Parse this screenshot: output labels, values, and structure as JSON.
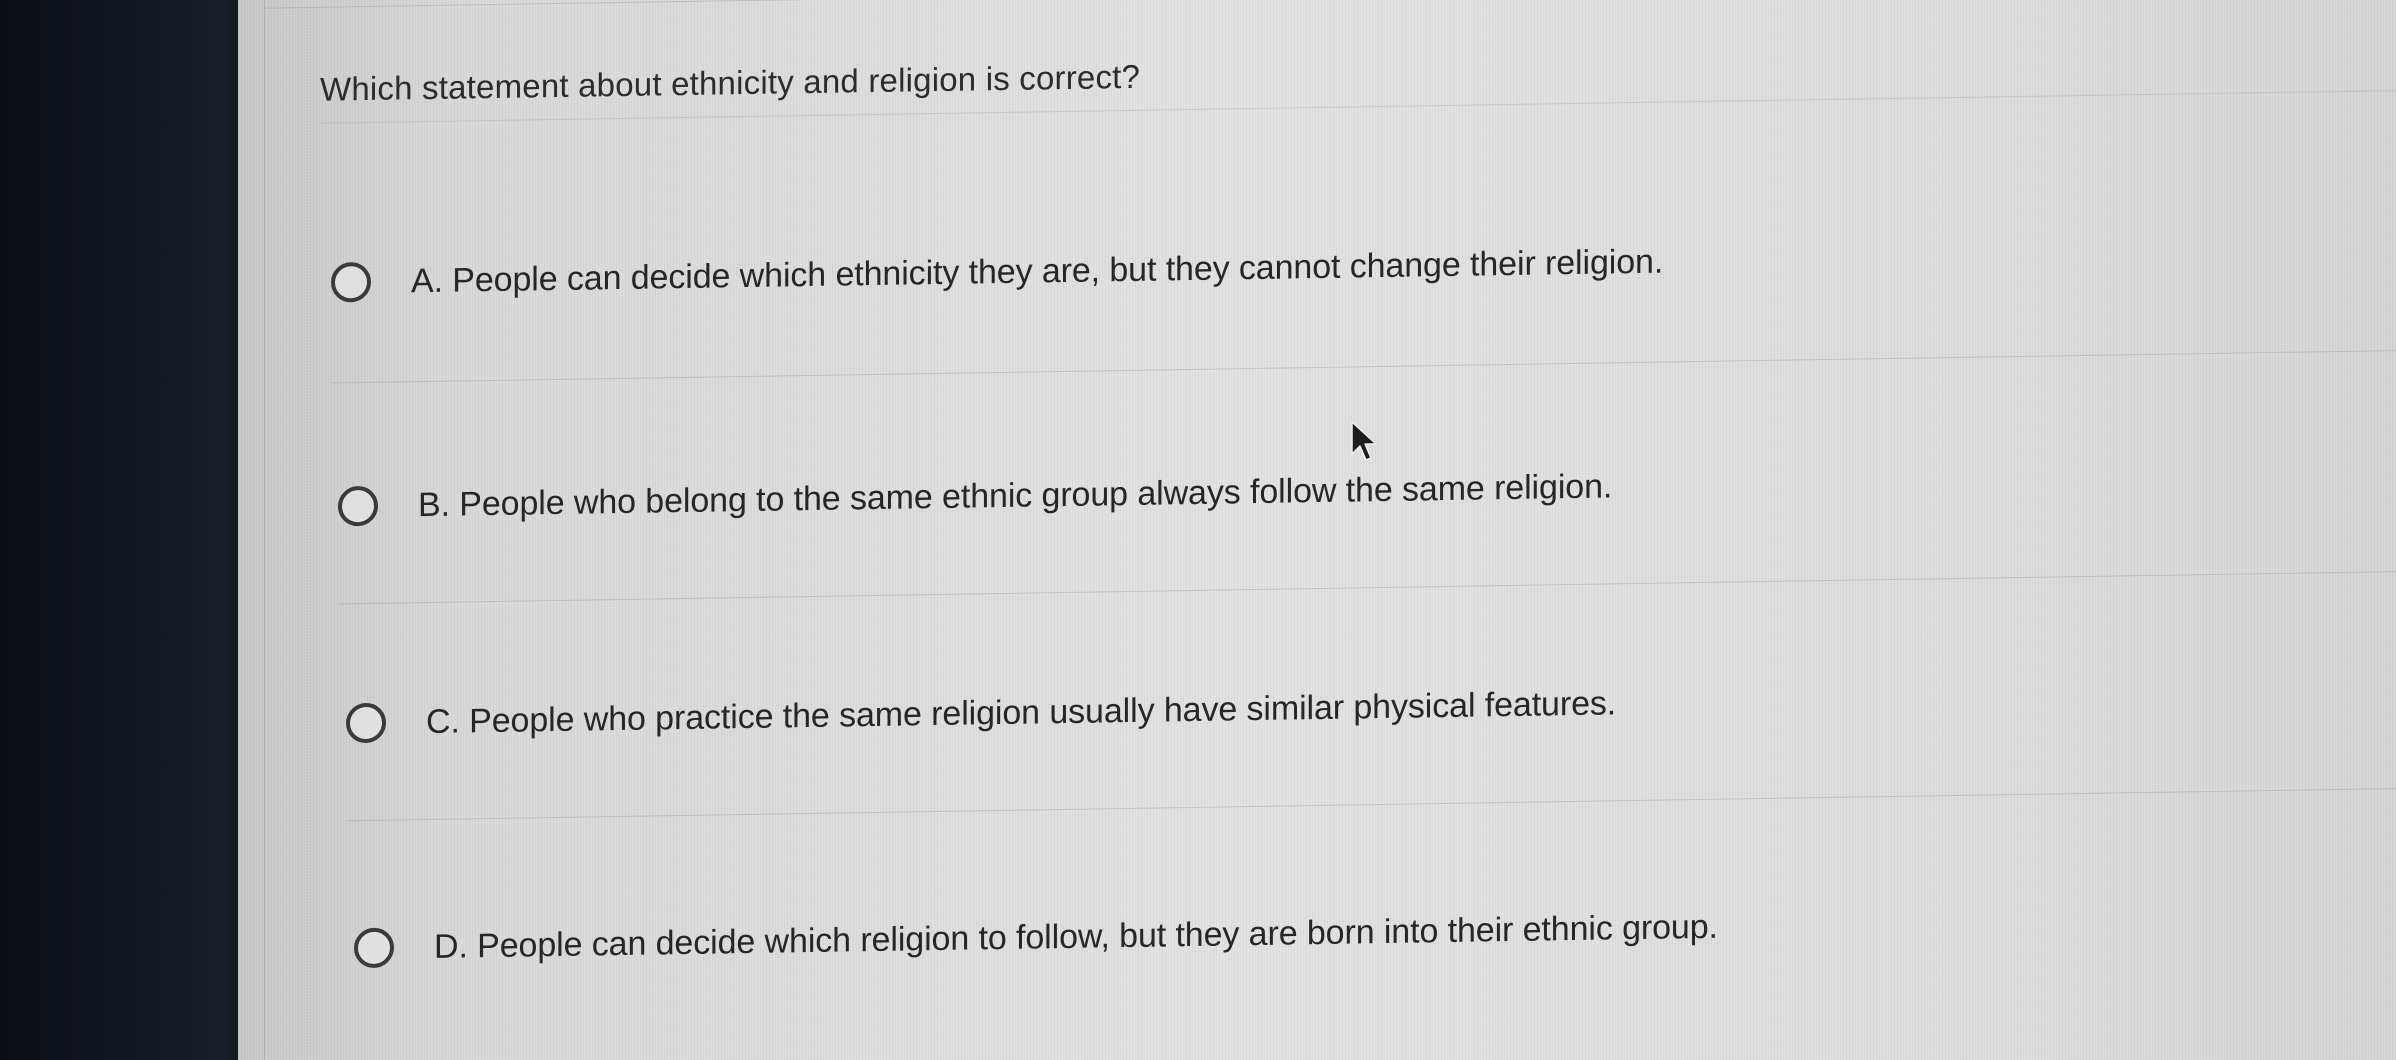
{
  "question": {
    "text": "Which statement about ethnicity and religion is correct?"
  },
  "options": [
    {
      "label": "A. People can decide which ethnicity they are, but they cannot change their religion.",
      "selected": false
    },
    {
      "label": "B. People who belong to the same ethnic group always follow the same religion.",
      "selected": false
    },
    {
      "label": "C. People who practice the same religion usually have similar physical features.",
      "selected": false
    },
    {
      "label": "D. People can decide which religion to follow, but they are born into their ethnic group.",
      "selected": false
    }
  ],
  "icons": {
    "radio": "radio-circle-icon",
    "cursor": "mouse-pointer-icon"
  },
  "colors": {
    "background": "#dcdcdc",
    "text": "#262626",
    "bezel": "#131822"
  }
}
